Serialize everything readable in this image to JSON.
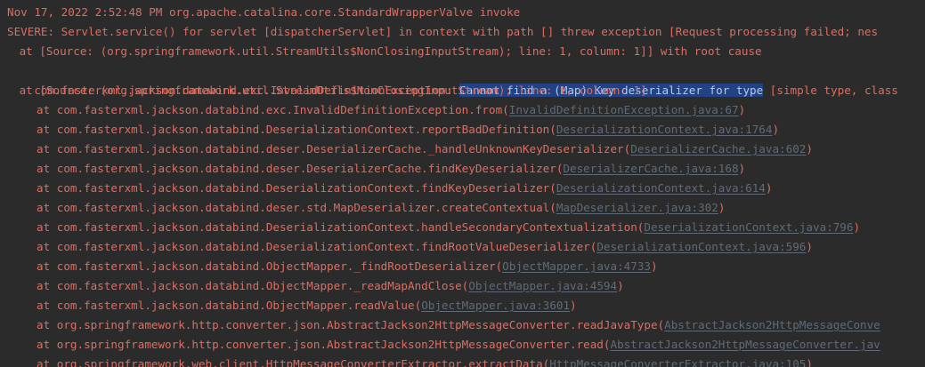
{
  "console": {
    "header_lines": [
      "Nov 17, 2022 2:52:48 PM org.apache.catalina.core.StandardWrapperValve invoke",
      "SEVERE: Servlet.service() for servlet [dispatcherServlet] in context with path [] threw exception [Request processing failed; nes",
      " at [Source: (org.springframework.util.StreamUtils$NonClosingInputStream); line: 1, column: 1]] with root cause"
    ],
    "exception": {
      "prefix": "com.fasterxml.jackson.databind.exc.InvalidDefinitionException: ",
      "selected": "Cannot find a (Map) Key deserializer for type",
      "suffix": " [simple type, class"
    },
    "source_line": " at [Source: (org.springframework.util.StreamUtils$NonClosingInputStream); line: 1, column: 1]",
    "frames": [
      {
        "method": "at com.fasterxml.jackson.databind.exc.InvalidDefinitionException.from(",
        "link": "InvalidDefinitionException.java:67",
        "close": ")"
      },
      {
        "method": "at com.fasterxml.jackson.databind.DeserializationContext.reportBadDefinition(",
        "link": "DeserializationContext.java:1764",
        "close": ")"
      },
      {
        "method": "at com.fasterxml.jackson.databind.deser.DeserializerCache._handleUnknownKeyDeserializer(",
        "link": "DeserializerCache.java:602",
        "close": ")"
      },
      {
        "method": "at com.fasterxml.jackson.databind.deser.DeserializerCache.findKeyDeserializer(",
        "link": "DeserializerCache.java:168",
        "close": ")"
      },
      {
        "method": "at com.fasterxml.jackson.databind.DeserializationContext.findKeyDeserializer(",
        "link": "DeserializationContext.java:614",
        "close": ")"
      },
      {
        "method": "at com.fasterxml.jackson.databind.deser.std.MapDeserializer.createContextual(",
        "link": "MapDeserializer.java:302",
        "close": ")"
      },
      {
        "method": "at com.fasterxml.jackson.databind.DeserializationContext.handleSecondaryContextualization(",
        "link": "DeserializationContext.java:796",
        "close": ")"
      },
      {
        "method": "at com.fasterxml.jackson.databind.DeserializationContext.findRootValueDeserializer(",
        "link": "DeserializationContext.java:596",
        "close": ")"
      },
      {
        "method": "at com.fasterxml.jackson.databind.ObjectMapper._findRootDeserializer(",
        "link": "ObjectMapper.java:4733",
        "close": ")"
      },
      {
        "method": "at com.fasterxml.jackson.databind.ObjectMapper._readMapAndClose(",
        "link": "ObjectMapper.java:4594",
        "close": ")"
      },
      {
        "method": "at com.fasterxml.jackson.databind.ObjectMapper.readValue(",
        "link": "ObjectMapper.java:3601",
        "close": ")"
      },
      {
        "method": "at org.springframework.http.converter.json.AbstractJackson2HttpMessageConverter.readJavaType(",
        "link": "AbstractJackson2HttpMessageConve",
        "close": ""
      },
      {
        "method": "at org.springframework.http.converter.json.AbstractJackson2HttpMessageConverter.read(",
        "link": "AbstractJackson2HttpMessageConverter.jav",
        "close": ""
      },
      {
        "method": "at org.springframework.web.client.HttpMessageConverterExtractor.extractData(",
        "link": "HttpMessageConverterExtractor.java:105",
        "close": ")"
      }
    ]
  }
}
